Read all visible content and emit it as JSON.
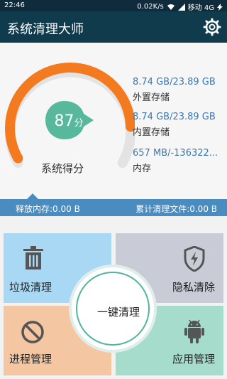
{
  "status": {
    "time": "22:46",
    "speed": "0.02K/s",
    "carrier": "移动 4G",
    "charge_icon": "lightning-icon"
  },
  "header": {
    "title": "系统清理大师",
    "settings_icon": "gear-icon"
  },
  "score": {
    "value": "87",
    "unit": "分",
    "label": "系统得分",
    "fraction": 0.87,
    "accent": "#f47a20",
    "badge_color": "#58b89c"
  },
  "stats": [
    {
      "value": "8.74 GB/23.89 GB",
      "label": "外置存储"
    },
    {
      "value": "8.74 GB/23.89 GB",
      "label": "内置存储"
    },
    {
      "value": "657 MB/-136322...",
      "label": "内存"
    }
  ],
  "infobar": {
    "left": "释放内存:0.00 B",
    "right": "累计清理文件:0.00 B"
  },
  "tiles": {
    "trash": {
      "label": "垃圾清理",
      "icon": "trash-icon"
    },
    "privacy": {
      "label": "隐私清除",
      "icon": "shield-icon"
    },
    "process": {
      "label": "进程管理",
      "icon": "ban-icon"
    },
    "apps": {
      "label": "应用管理",
      "icon": "android-icon"
    },
    "center": {
      "label": "一键清理"
    }
  }
}
